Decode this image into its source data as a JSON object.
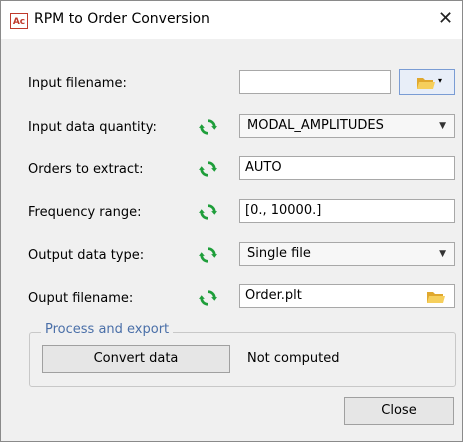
{
  "window": {
    "title": "RPM to Order Conversion",
    "icon_text": "Ac"
  },
  "form": {
    "input_filename": {
      "label": "Input filename:",
      "value": ""
    },
    "input_data_quantity": {
      "label": "Input data quantity:",
      "value": "MODAL_AMPLITUDES"
    },
    "orders_to_extract": {
      "label": "Orders to extract:",
      "value": "AUTO"
    },
    "frequency_range": {
      "label": "Frequency range:",
      "value": "[0., 10000.]"
    },
    "output_data_type": {
      "label": "Output data type:",
      "value": "Single file"
    },
    "output_filename": {
      "label": "Ouput filename:",
      "value": "Order.plt"
    }
  },
  "process": {
    "group_title": "Process and export",
    "convert_label": "Convert data",
    "status": "Not computed"
  },
  "footer": {
    "close_label": "Close"
  },
  "colors": {
    "sync_green": "#1e9e3a",
    "folder_yellow": "#f2c04d",
    "group_title": "#4a6fa8"
  }
}
